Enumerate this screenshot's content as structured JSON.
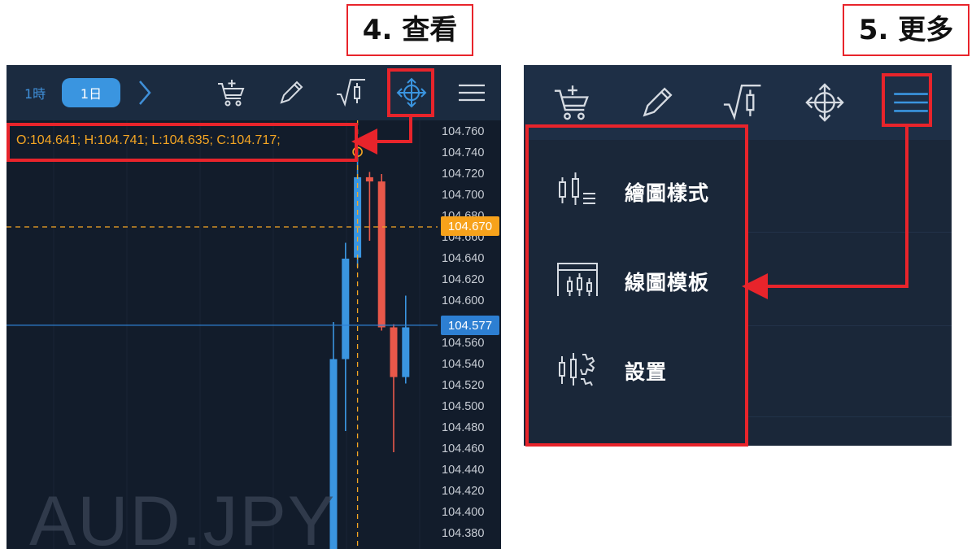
{
  "callouts": {
    "view": "4. 查看",
    "more": "5. 更多"
  },
  "chart": {
    "symbol": "AUD.JPY",
    "timeframes": [
      {
        "label": "1時",
        "selected": false
      },
      {
        "label": "1日",
        "selected": true
      }
    ],
    "toolbar_icons": [
      "cart-plus-icon",
      "pencil-icon",
      "indicator-icon",
      "crosshair-icon",
      "hamburger-menu-icon"
    ],
    "ohlc_readout": "O:104.641; H:104.741; L:104.635; C:104.717;",
    "price_ticks": [
      "104.760",
      "104.740",
      "104.720",
      "104.700",
      "104.680",
      "104.660",
      "104.640",
      "104.620",
      "104.600",
      "104.580",
      "104.560",
      "104.540",
      "104.520",
      "104.500",
      "104.480",
      "104.460",
      "104.440",
      "104.420",
      "104.400",
      "104.380"
    ],
    "crosshair_price": "104.670",
    "current_price": "104.577",
    "colors": {
      "up": "#3a95e0",
      "down": "#e8584a",
      "crosshair": "#f5a623",
      "price_line": "#2d7fd2"
    },
    "candles": [
      {
        "open": 104.38,
        "close": 104.545,
        "high": 104.58,
        "low": 104.38
      },
      {
        "open": 104.545,
        "close": 104.64,
        "high": 104.655,
        "low": 104.48
      },
      {
        "open": 104.641,
        "close": 104.717,
        "high": 104.741,
        "low": 104.635
      },
      {
        "open": 104.717,
        "close": 104.713,
        "high": 104.722,
        "low": 104.66
      },
      {
        "open": 104.713,
        "close": 104.575,
        "high": 104.72,
        "low": 104.575
      },
      {
        "open": 104.575,
        "close": 104.528,
        "high": 104.578,
        "low": 104.46
      },
      {
        "open": 104.528,
        "close": 104.575,
        "high": 104.605,
        "low": 104.525
      }
    ]
  },
  "menu": {
    "toolbar_icons": [
      "cart-plus-icon",
      "pencil-icon",
      "indicator-icon",
      "crosshair-icon",
      "hamburger-menu-icon"
    ],
    "items": [
      {
        "label": "繪圖樣式",
        "icon": "chart-style-icon"
      },
      {
        "label": "線圖模板",
        "icon": "chart-template-icon"
      },
      {
        "label": "設置",
        "icon": "settings-icon"
      }
    ]
  }
}
